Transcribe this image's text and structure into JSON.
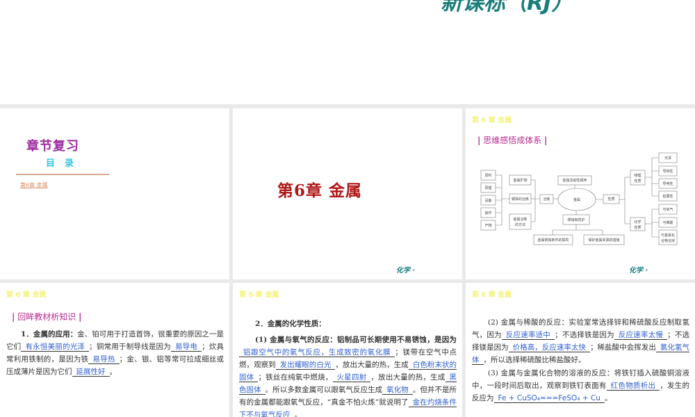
{
  "header": {
    "title": "新课标（RJ）"
  },
  "chapter_tag": "第 6 章 金属",
  "footer": "化学 ·",
  "slide1": {
    "title": "章节复习",
    "subtitle": "目录",
    "link": "第6章  金属"
  },
  "slide2": {
    "title": "第6章  金属"
  },
  "slide3": {
    "section": "思维感悟成体系",
    "nodes": {
      "raw": "原料",
      "principle": "原理",
      "equipment": "设备",
      "operation": "操作",
      "product": "产物",
      "ore": "金属矿物",
      "iron_smelting": "钢铁的冶炼",
      "method1": "金属冶炼",
      "method2": "的方法",
      "smelting": "冶炼",
      "metal": "金属",
      "activity": "金属活动性顺序",
      "corrosion": "锈蚀和防护",
      "explore": "金属锈蚀条件的探究",
      "protect": "保护金属资源的措施",
      "property": "性质",
      "phys1": "物理",
      "phys2": "性质",
      "chem1": "化学",
      "chem2": "性质",
      "luster": "光泽",
      "thermal": "导热性",
      "electric": "导电性",
      "ductile": "延展性",
      "oxygen": "与氧气",
      "acid": "与稀酸",
      "salt1": "与金属化",
      "salt2": "合物溶液"
    }
  },
  "slide4": {
    "section": "回眸教材析知识",
    "paragraph": [
      {
        "t": "1．金属的应用：",
        "b": true
      },
      {
        "t": "金、铂可用于打造首饰，很重要的原因之一是它们"
      },
      {
        "t": "有永恒美丽的光泽",
        "blank": true
      },
      {
        "t": "；铜常用于制导线是因为"
      },
      {
        "t": "易导电",
        "blank": true
      },
      {
        "t": "；炊具常利用铁制的，是因为铁"
      },
      {
        "t": "易导热",
        "blank": true
      },
      {
        "t": "；金、银、铝等常可拉成细丝或压成薄片是因为它们"
      },
      {
        "t": "延展性好",
        "blank": true
      },
      {
        "t": "。"
      }
    ]
  },
  "slide5": {
    "heading": "2．金属的化学性质：",
    "paragraph": [
      {
        "t": "(1) 金属与氧气的反应：铝制品可长期使用不易锈蚀，是因为",
        "b": true
      },
      {
        "t": "铝跟空气中的氧气反应，生成致密的氧化膜",
        "blank": true
      },
      {
        "t": "；镁带在空气中点燃，观察到"
      },
      {
        "t": "发出耀眼的白光",
        "blank": true
      },
      {
        "t": "，放出大量的热，生成"
      },
      {
        "t": "白色粉末状的固体",
        "blank": true
      },
      {
        "t": "；铁丝在纯氧中燃烧，"
      },
      {
        "t": "火星四射",
        "blank": true
      },
      {
        "t": "，放出大量的热，生成"
      },
      {
        "t": "黑色固体",
        "blank": true
      },
      {
        "t": "。所以多数金属可以跟氧气反应生成"
      },
      {
        "t": "氧化物",
        "blank": true
      },
      {
        "t": "。但并不是所有的金属都能跟氧气反应，“真金不怕火炼”就说明了"
      },
      {
        "t": "金在灼烧条件下不与氧气反应",
        "blank": true
      },
      {
        "t": "。"
      }
    ]
  },
  "slide6": {
    "paragraph1": [
      {
        "t": "(2) 金属与稀酸的反应：实验室常选择锌和稀硫酸反应制取氢气，因为"
      },
      {
        "t": "反应速率适中",
        "blank": true
      },
      {
        "t": "；不选择铁是因为"
      },
      {
        "t": "反应速率太慢",
        "blank": true
      },
      {
        "t": "；不选择镁是因为"
      },
      {
        "t": "价格高，反应速率太快",
        "blank": true
      },
      {
        "t": "；稀盐酸中会挥发出"
      },
      {
        "t": "氯化氢气体",
        "blank": true
      },
      {
        "t": "，所以选择稀硫酸比稀盐酸好。"
      }
    ],
    "paragraph2": [
      {
        "t": "(3) 金属与金属化合物的溶液的反应：将铁钉插入硫酸铜溶液中，一段时间后取出，观察到铁钉表面有"
      },
      {
        "t": "红色物质析出",
        "blank": true
      },
      {
        "t": "，发生的反应为"
      },
      {
        "t": "Fe + CuSO₄===FeSO₄ + Cu",
        "blank": true
      },
      {
        "t": "。"
      }
    ]
  }
}
